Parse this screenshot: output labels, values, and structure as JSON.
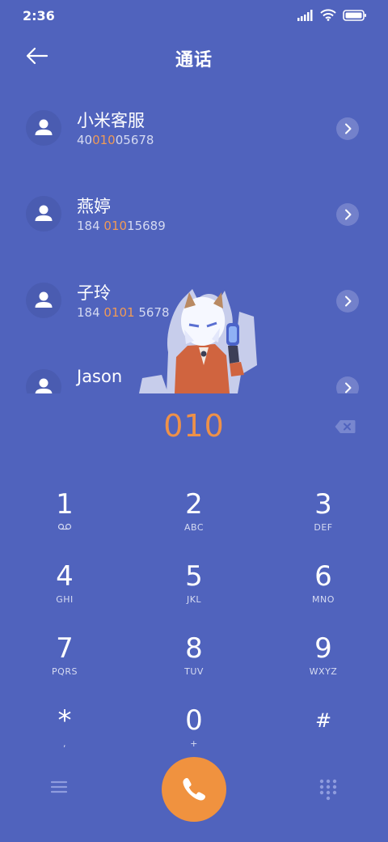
{
  "status": {
    "time": "2:36"
  },
  "header": {
    "title": "通话"
  },
  "contacts": [
    {
      "name": "小米客服",
      "num_pre": "40",
      "num_hl": "010",
      "num_post": "05678"
    },
    {
      "name": "燕婷",
      "num_pre": "184 ",
      "num_hl": "010",
      "num_post": "15689"
    },
    {
      "name": "子玲",
      "num_pre": "184 ",
      "num_hl": "0101",
      "num_post": " 5678"
    },
    {
      "name": "Jason",
      "num_pre": "",
      "num_hl": "",
      "num_post": ""
    }
  ],
  "dial": {
    "entry": "010"
  },
  "keys": [
    {
      "digit": "1",
      "letters": ""
    },
    {
      "digit": "2",
      "letters": "ABC"
    },
    {
      "digit": "3",
      "letters": "DEF"
    },
    {
      "digit": "4",
      "letters": "GHI"
    },
    {
      "digit": "5",
      "letters": "JKL"
    },
    {
      "digit": "6",
      "letters": "MNO"
    },
    {
      "digit": "7",
      "letters": "PQRS"
    },
    {
      "digit": "8",
      "letters": "TUV"
    },
    {
      "digit": "9",
      "letters": "WXYZ"
    },
    {
      "digit": "*",
      "letters": ","
    },
    {
      "digit": "0",
      "letters": "+"
    },
    {
      "digit": "#",
      "letters": ""
    }
  ],
  "icons": {
    "back": "arrow-left-icon",
    "delete": "backspace-icon",
    "call": "phone-icon",
    "menu": "menu-icon",
    "dialpad": "dialpad-icon",
    "voicemail": "voicemail-icon"
  },
  "colors": {
    "background": "#5063bd",
    "accent": "#f0923f",
    "match": "#f09a56"
  }
}
